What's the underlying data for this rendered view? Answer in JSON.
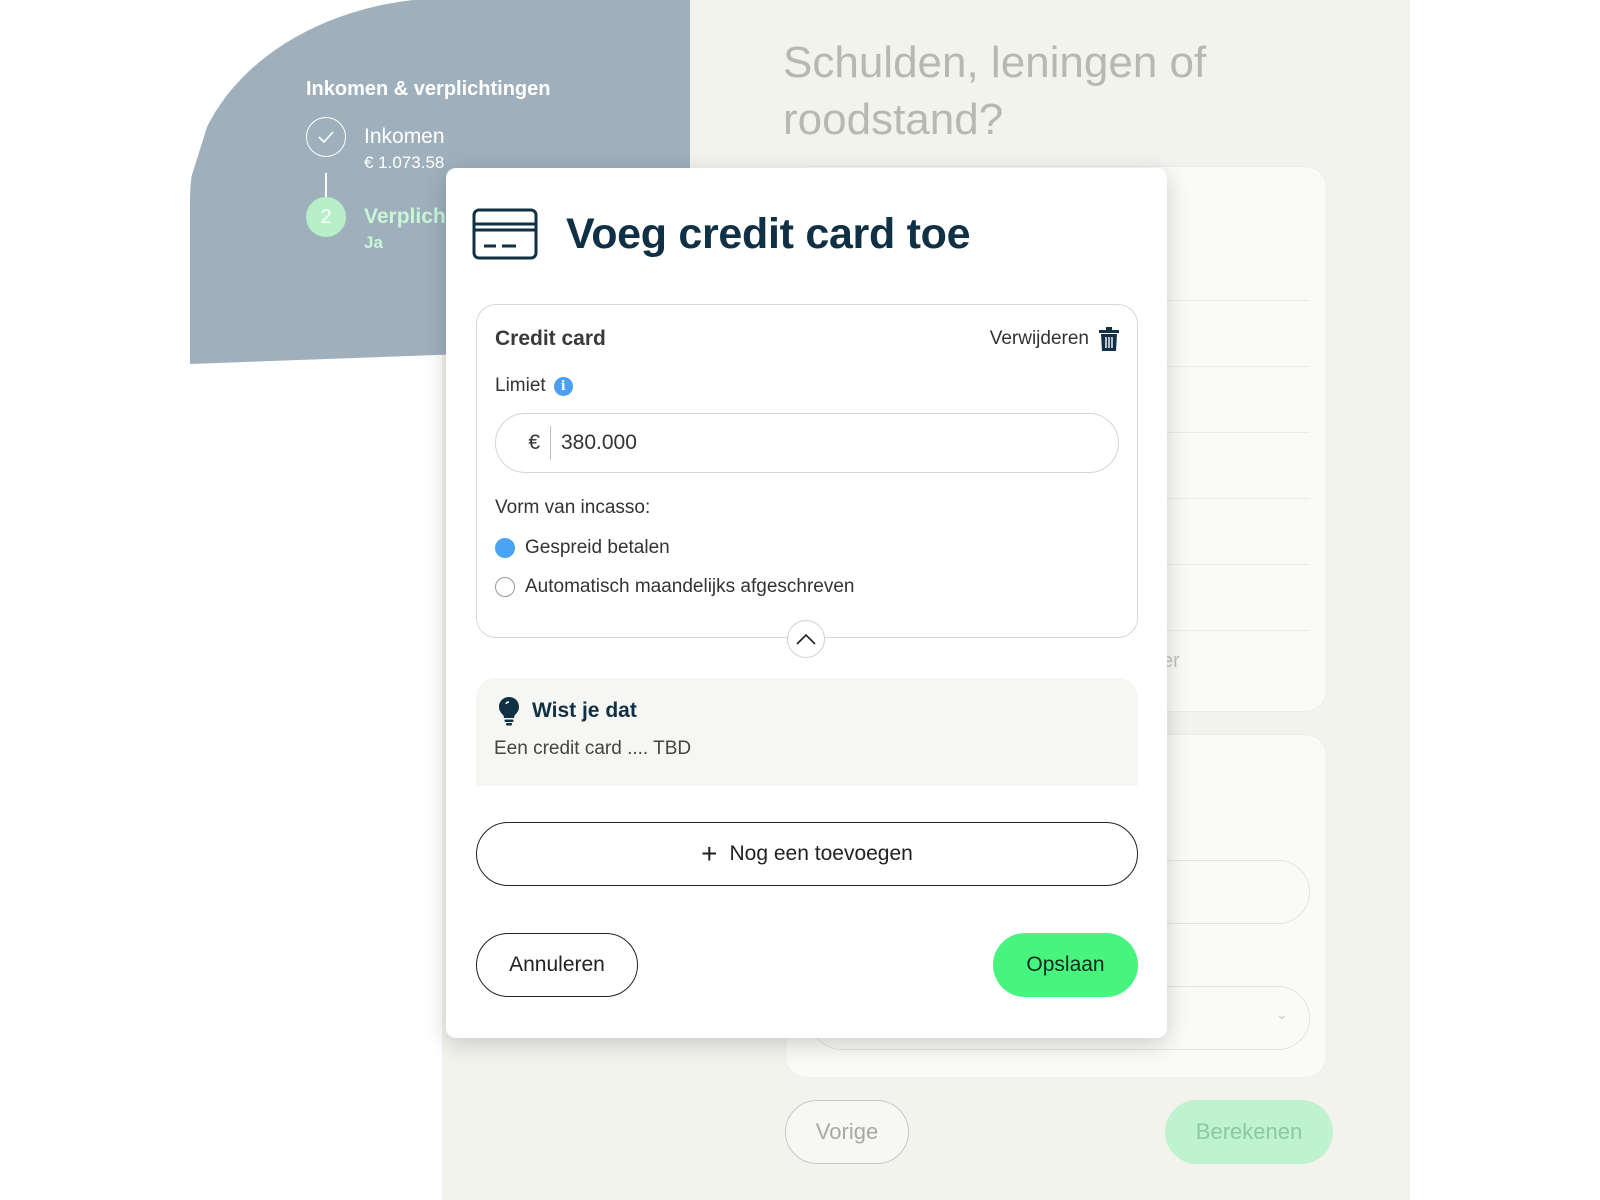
{
  "sidebar": {
    "title": "Inkomen & verplichtingen",
    "steps": [
      {
        "label": "Inkomen",
        "sub": "€ 1.073.58",
        "status": "done"
      },
      {
        "number": "2",
        "label": "Verplich",
        "sub": "Ja",
        "status": "active"
      }
    ]
  },
  "background": {
    "heading": "Schulden, leningen of roodstand?",
    "faint_text": "er",
    "prev_label": "Vorige",
    "calc_label": "Berekenen"
  },
  "modal": {
    "title": "Voeg credit card toe",
    "card": {
      "title": "Credit card",
      "remove_label": "Verwijderen",
      "limit_label": "Limiet",
      "currency": "€",
      "limit_value": "380.000",
      "incasso_label": "Vorm van incasso:",
      "options": [
        {
          "label": "Gespreid betalen",
          "checked": true
        },
        {
          "label": "Automatisch maandelijks afgeschreven",
          "checked": false
        }
      ]
    },
    "tip": {
      "title": "Wist je dat",
      "text": "Een credit card .... TBD"
    },
    "add_more_label": "Nog een toevoegen",
    "cancel_label": "Annuleren",
    "save_label": "Opslaan"
  },
  "colors": {
    "brand_dark": "#0f3045",
    "accent_green": "#47f57e",
    "radio_blue": "#4aa3f5",
    "sidebar_blue_gray": "#9fb0bc"
  }
}
